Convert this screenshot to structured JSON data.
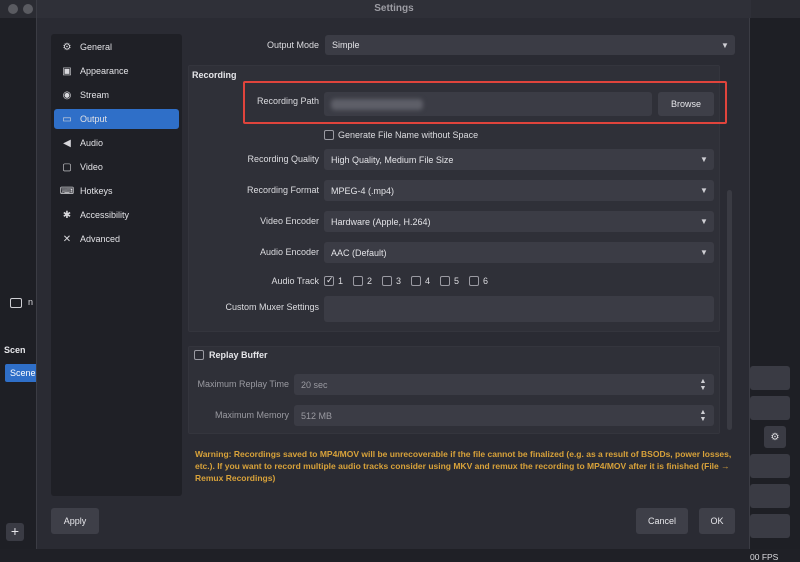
{
  "window": {
    "title": "Settings"
  },
  "sidebar": {
    "items": [
      {
        "label": "General",
        "icon": "gear-icon",
        "glyph": "⚙"
      },
      {
        "label": "Appearance",
        "icon": "monitor-icon",
        "glyph": "▣"
      },
      {
        "label": "Stream",
        "icon": "antenna-icon",
        "glyph": "◉"
      },
      {
        "label": "Output",
        "icon": "output-icon",
        "glyph": "▭",
        "active": true
      },
      {
        "label": "Audio",
        "icon": "speaker-icon",
        "glyph": "◀"
      },
      {
        "label": "Video",
        "icon": "video-icon",
        "glyph": "▢"
      },
      {
        "label": "Hotkeys",
        "icon": "keyboard-icon",
        "glyph": "⌨"
      },
      {
        "label": "Accessibility",
        "icon": "accessibility-icon",
        "glyph": "✱"
      },
      {
        "label": "Advanced",
        "icon": "wrench-icon",
        "glyph": "✕"
      }
    ]
  },
  "output_mode": {
    "label": "Output Mode",
    "value": "Simple"
  },
  "recording": {
    "title": "Recording",
    "path_label": "Recording Path",
    "browse_label": "Browse",
    "gen_filename_label": "Generate File Name without Space",
    "quality_label": "Recording Quality",
    "quality_value": "High Quality, Medium File Size",
    "format_label": "Recording Format",
    "format_value": "MPEG-4 (.mp4)",
    "video_encoder_label": "Video Encoder",
    "video_encoder_value": "Hardware (Apple, H.264)",
    "audio_encoder_label": "Audio Encoder",
    "audio_encoder_value": "AAC (Default)",
    "audio_track_label": "Audio Track",
    "audio_tracks": [
      "1",
      "2",
      "3",
      "4",
      "5",
      "6"
    ],
    "muxer_label": "Custom Muxer Settings"
  },
  "replay": {
    "title": "Replay Buffer",
    "max_time_label": "Maximum Replay Time",
    "max_time_value": "20 sec",
    "max_mem_label": "Maximum Memory",
    "max_mem_value": "512 MB"
  },
  "warning": "Warning: Recordings saved to MP4/MOV will be unrecoverable if the file cannot be finalized (e.g. as a result of BSODs, power losses, etc.). If you want to record multiple audio tracks consider using MKV and remux the recording to MP4/MOV after it is finished (File → Remux Recordings)",
  "footer": {
    "apply": "Apply",
    "cancel": "Cancel",
    "ok": "OK"
  },
  "background": {
    "scene_label": "Scen",
    "scene_item": "Scene",
    "fps": "00 FPS",
    "letter_n": "n"
  },
  "colors": {
    "accent": "#2f6fc8",
    "warning": "#d8a23a",
    "highlight": "#e0443c"
  }
}
